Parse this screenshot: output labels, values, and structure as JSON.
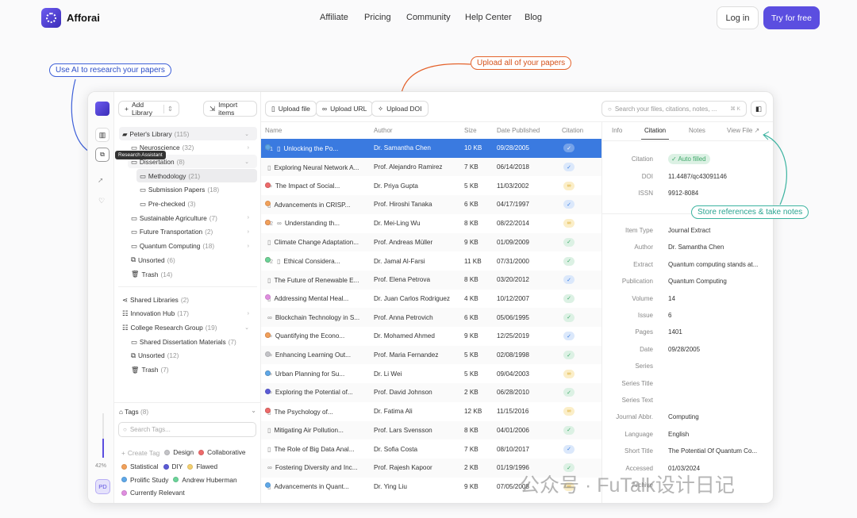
{
  "brand": {
    "name": "Afforai",
    "accent": "#5b4ee0"
  },
  "nav": [
    "Affiliate",
    "Pricing",
    "Community",
    "Help Center",
    "Blog"
  ],
  "login": "Log in",
  "try": "Try for free",
  "annotations": {
    "research": "Use AI to research your papers",
    "upload": "Upload all of your papers",
    "store": "Store references & take notes"
  },
  "sidebar": {
    "add_library": "Add Library",
    "import": "Import items",
    "tooltip": "Research Assistant",
    "usage": "42%",
    "usage_fraction": 0.42,
    "avatar": "PD",
    "tree": [
      {
        "label": "Peter's Library",
        "count": "(115)",
        "level": 0,
        "icon": "folder-open",
        "chev": "v"
      },
      {
        "label": "Neuroscience",
        "count": "(32)",
        "level": 1,
        "icon": "folder",
        "chev": ">"
      },
      {
        "label": "Dissertation",
        "count": "(8)",
        "level": 1,
        "icon": "folder",
        "chev": "v"
      },
      {
        "label": "Methodology",
        "count": "(21)",
        "level": 2,
        "icon": "folder",
        "sel": true
      },
      {
        "label": "Submission Papers",
        "count": "(18)",
        "level": 2,
        "icon": "folder"
      },
      {
        "label": "Pre-checked",
        "count": "(3)",
        "level": 2,
        "icon": "folder"
      },
      {
        "label": "Sustainable Agriculture",
        "count": "(7)",
        "level": 1,
        "icon": "folder",
        "chev": ">"
      },
      {
        "label": "Future Transportation",
        "count": "(2)",
        "level": 1,
        "icon": "folder",
        "chev": ">"
      },
      {
        "label": "Quantum Computing",
        "count": "(18)",
        "level": 1,
        "icon": "folder",
        "chev": ">"
      },
      {
        "label": "Unsorted",
        "count": "(6)",
        "level": 1,
        "icon": "unsorted"
      },
      {
        "label": "Trash",
        "count": "(14)",
        "level": 1,
        "icon": "trash"
      }
    ],
    "shared": [
      {
        "label": "Shared Libraries",
        "count": "(2)",
        "level": 0,
        "icon": "share"
      },
      {
        "label": "Innovation Hub",
        "count": "(17)",
        "level": 0,
        "icon": "group",
        "chev": ">"
      },
      {
        "label": "College Research Group",
        "count": "(19)",
        "level": 0,
        "icon": "group",
        "chev": "v"
      },
      {
        "label": "Shared Dissertation Materials",
        "count": "(7)",
        "level": 1,
        "icon": "folder"
      },
      {
        "label": "Unsorted",
        "count": "(12)",
        "level": 1,
        "icon": "unsorted"
      },
      {
        "label": "Trash",
        "count": "(7)",
        "level": 1,
        "icon": "trash"
      }
    ],
    "tags_title": "Tags",
    "tags_count": "(8)",
    "tag_search_placeholder": "Search Tags...",
    "create_tag": "Create Tag",
    "tags": [
      {
        "label": "Design",
        "color": "#c4c4c8"
      },
      {
        "label": "Collaborative",
        "color": "#ee6b6b"
      },
      {
        "label": "Statistical",
        "color": "#f2a15a"
      },
      {
        "label": "DIY",
        "color": "#5b5bd6"
      },
      {
        "label": "Flawed",
        "color": "#f4d06f"
      },
      {
        "label": "Prolific Study",
        "color": "#5fa8e8"
      },
      {
        "label": "Andrew Huberman",
        "color": "#6cd49a"
      },
      {
        "label": "Currently Relevant",
        "color": "#e08ee0"
      }
    ]
  },
  "toolbar": {
    "upload_file": "Upload file",
    "upload_url": "Upload URL",
    "upload_doi": "Upload DOI",
    "search_placeholder": "Search your files, citations, notes, ...",
    "shortcut": "⌘ K"
  },
  "table": {
    "columns": [
      "Name",
      "Author",
      "Size",
      "Date Published",
      "Citation"
    ],
    "colors": {
      "gray": "#c4c4c8",
      "red": "#ee6b6b",
      "orange": "#f2a15a",
      "indigo": "#5b5bd6",
      "pink": "#e08ee0",
      "green": "#6cd49a",
      "blue": "#5fa8e8",
      "yellow": "#e8c547"
    },
    "rows": [
      {
        "dots": [
          "yellow",
          "green",
          "blue"
        ],
        "more": "+1",
        "type": "file",
        "name": "Unlocking the Po...",
        "author": "Dr. Samantha Chen",
        "size": "10 KB",
        "date": "09/28/2005",
        "citation": "blue",
        "selected": true
      },
      {
        "dots": [],
        "type": "file",
        "name": "Exploring Neural Network A...",
        "author": "Prof. Alejandro Ramirez",
        "size": "7 KB",
        "date": "06/14/2018",
        "citation": "blue"
      },
      {
        "dots": [
          "gray",
          "red"
        ],
        "type": "link",
        "name": "The Impact of Social...",
        "author": "Dr. Priya Gupta",
        "size": "5 KB",
        "date": "11/03/2002",
        "citation": "yellow"
      },
      {
        "dots": [
          "orange"
        ],
        "type": "file",
        "name": "Advancements in CRISP...",
        "author": "Prof. Hiroshi Tanaka",
        "size": "6 KB",
        "date": "04/17/1997",
        "citation": "blue"
      },
      {
        "dots": [
          "indigo",
          "pink",
          "orange"
        ],
        "more": "+2",
        "type": "link",
        "name": "Understanding th...",
        "author": "Dr. Mei-Ling Wu",
        "size": "8 KB",
        "date": "08/22/2014",
        "citation": "yellow"
      },
      {
        "dots": [],
        "type": "file",
        "name": "Climate Change Adaptation...",
        "author": "Prof. Andreas Müller",
        "size": "9 KB",
        "date": "01/09/2009",
        "citation": "green"
      },
      {
        "dots": [
          "red",
          "orange",
          "green"
        ],
        "more": "+2",
        "type": "file",
        "name": "Ethical Considera...",
        "author": "Dr. Jamal Al-Farsi",
        "size": "11 KB",
        "date": "07/31/2000",
        "citation": "green"
      },
      {
        "dots": [],
        "type": "file",
        "name": "The Future of Renewable E...",
        "author": "Prof. Elena Petrova",
        "size": "8 KB",
        "date": "03/20/2012",
        "citation": "blue"
      },
      {
        "dots": [
          "pink"
        ],
        "type": "file",
        "name": "Addressing Mental Heal...",
        "author": "Dr. Juan Carlos Rodriguez",
        "size": "4 KB",
        "date": "10/12/2007",
        "citation": "green"
      },
      {
        "dots": [],
        "type": "link",
        "name": "Blockchain Technology in S...",
        "author": "Prof. Anna Petrovich",
        "size": "6 KB",
        "date": "05/06/1995",
        "citation": "green"
      },
      {
        "dots": [
          "red",
          "orange"
        ],
        "type": "link",
        "name": "Quantifying the Econo...",
        "author": "Dr. Mohamed Ahmed",
        "size": "9 KB",
        "date": "12/25/2019",
        "citation": "blue"
      },
      {
        "dots": [
          "gray"
        ],
        "type": "link",
        "name": "Enhancing Learning Out...",
        "author": "Prof. Maria Fernandez",
        "size": "5 KB",
        "date": "02/08/1998",
        "citation": "green"
      },
      {
        "dots": [
          "orange",
          "blue"
        ],
        "type": "link",
        "name": "Urban Planning for Su...",
        "author": "Dr. Li Wei",
        "size": "5 KB",
        "date": "09/04/2003",
        "citation": "yellow"
      },
      {
        "dots": [
          "indigo"
        ],
        "type": "link",
        "name": "Exploring the Potential of...",
        "author": "Prof. David Johnson",
        "size": "2 KB",
        "date": "06/28/2010",
        "citation": "green"
      },
      {
        "dots": [
          "blue",
          "orange",
          "red"
        ],
        "type": "file",
        "name": "The Psychology of...",
        "author": "Dr. Fatima Ali",
        "size": "12 KB",
        "date": "11/15/2016",
        "citation": "yellow"
      },
      {
        "dots": [],
        "type": "file",
        "name": "Mitigating Air Pollution...",
        "author": "Prof. Lars Svensson",
        "size": "8 KB",
        "date": "04/01/2006",
        "citation": "green"
      },
      {
        "dots": [],
        "type": "file",
        "name": "The Role of Big Data Anal...",
        "author": "Dr. Sofia Costa",
        "size": "7 KB",
        "date": "08/10/2017",
        "citation": "blue"
      },
      {
        "dots": [],
        "type": "link",
        "name": "Fostering Diversity and Inc...",
        "author": "Prof. Rajesh Kapoor",
        "size": "2 KB",
        "date": "01/19/1996",
        "citation": "green"
      },
      {
        "dots": [
          "blue"
        ],
        "type": "file",
        "name": "Advancements in Quant...",
        "author": "Dr. Ying Liu",
        "size": "9 KB",
        "date": "07/05/2008",
        "citation": "yellow"
      }
    ]
  },
  "panel": {
    "tabs": [
      "Info",
      "Citation",
      "Notes",
      "View File ↗"
    ],
    "active_tab": 1,
    "citation": [
      {
        "k": "Citation",
        "v": "Auto filled",
        "badge": true
      },
      {
        "k": "DOI",
        "v": "11.4487/qc43091146"
      },
      {
        "k": "ISSN",
        "v": "9912-8084"
      }
    ],
    "fields": [
      {
        "k": "Item Type",
        "v": "Journal Extract"
      },
      {
        "k": "Author",
        "v": "Dr. Samantha Chen"
      },
      {
        "k": "Extract",
        "v": "Quantum computing stands at..."
      },
      {
        "k": "Publication",
        "v": "Quantum Computing"
      },
      {
        "k": "Volume",
        "v": "14"
      },
      {
        "k": "Issue",
        "v": "6"
      },
      {
        "k": "Pages",
        "v": "1401"
      },
      {
        "k": "Date",
        "v": "09/28/2005"
      },
      {
        "k": "Series",
        "v": ""
      },
      {
        "k": "Series Title",
        "v": ""
      },
      {
        "k": "Series Text",
        "v": ""
      },
      {
        "k": "Journal Abbr.",
        "v": "Computing"
      },
      {
        "k": "Language",
        "v": "English"
      },
      {
        "k": "Short Title",
        "v": "The Potential Of Quantum Co..."
      },
      {
        "k": "Accessed",
        "v": "01/03/2024"
      },
      {
        "k": "Archive",
        "v": ""
      }
    ]
  },
  "watermark": "公众号 · FuTalk设计日记"
}
